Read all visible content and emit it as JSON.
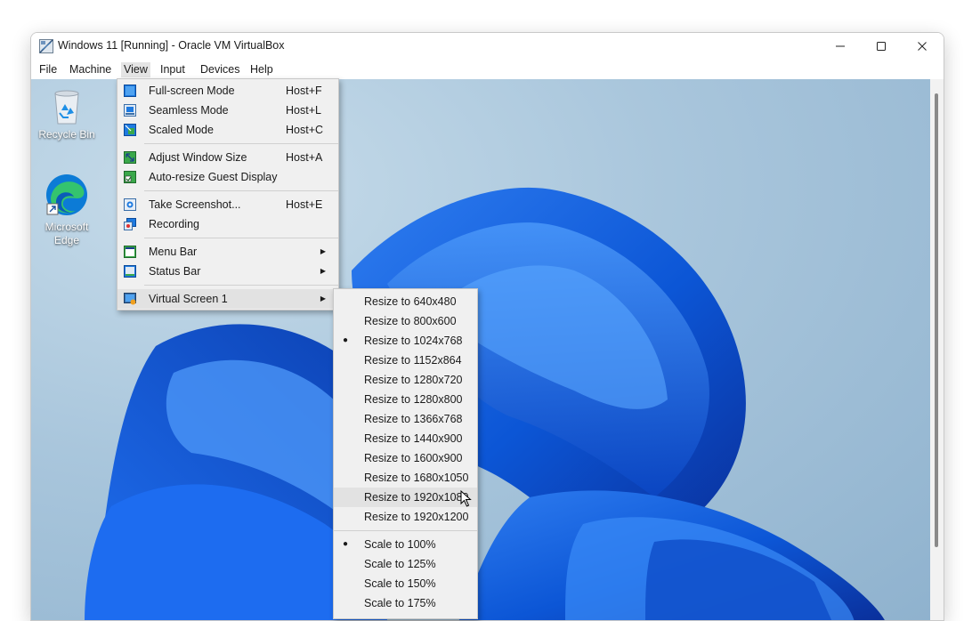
{
  "window": {
    "title": "Windows 11 [Running] - Oracle VM VirtualBox"
  },
  "menubar": {
    "items": [
      "File",
      "Machine",
      "View",
      "Input",
      "Devices",
      "Help"
    ]
  },
  "desktop": {
    "icons": [
      {
        "label": "Recycle Bin"
      },
      {
        "label": "Microsoft Edge"
      }
    ]
  },
  "view_menu": {
    "items": [
      {
        "label": "Full-screen Mode",
        "shortcut": "Host+F",
        "icon": "fullscreen-icon"
      },
      {
        "label": "Seamless Mode",
        "shortcut": "Host+L",
        "icon": "seamless-icon"
      },
      {
        "label": "Scaled Mode",
        "shortcut": "Host+C",
        "icon": "scaled-icon"
      },
      {
        "label": "Adjust Window Size",
        "shortcut": "Host+A",
        "icon": "adjust-window-icon"
      },
      {
        "label": "Auto-resize Guest Display",
        "shortcut": "",
        "icon": "auto-resize-icon"
      },
      {
        "label": "Take Screenshot...",
        "shortcut": "Host+E",
        "icon": "screenshot-icon"
      },
      {
        "label": "Recording",
        "shortcut": "",
        "icon": "recording-icon"
      },
      {
        "label": "Menu Bar",
        "shortcut": "",
        "icon": "menu-bar-icon"
      },
      {
        "label": "Status Bar",
        "shortcut": "",
        "icon": "status-bar-icon"
      },
      {
        "label": "Virtual Screen 1",
        "shortcut": "",
        "icon": "virtual-screen-icon"
      }
    ]
  },
  "virtual_screen_submenu": {
    "resize": [
      "Resize to 640x480",
      "Resize to 800x600",
      "Resize to 1024x768",
      "Resize to 1152x864",
      "Resize to 1280x720",
      "Resize to 1280x800",
      "Resize to 1366x768",
      "Resize to 1440x900",
      "Resize to 1600x900",
      "Resize to 1680x1050",
      "Resize to 1920x1080",
      "Resize to 1920x1200"
    ],
    "scale": [
      "Scale to 100%",
      "Scale to 125%",
      "Scale to 150%",
      "Scale to 175%"
    ],
    "selected_resize": "Resize to 1024x768",
    "selected_scale": "Scale to 100%",
    "hovered": "Resize to 1920x1080"
  },
  "colors": {
    "accent_blue": "#1565d8",
    "menu_bg": "#f0f0f0",
    "highlight": "#e2e2e2"
  }
}
